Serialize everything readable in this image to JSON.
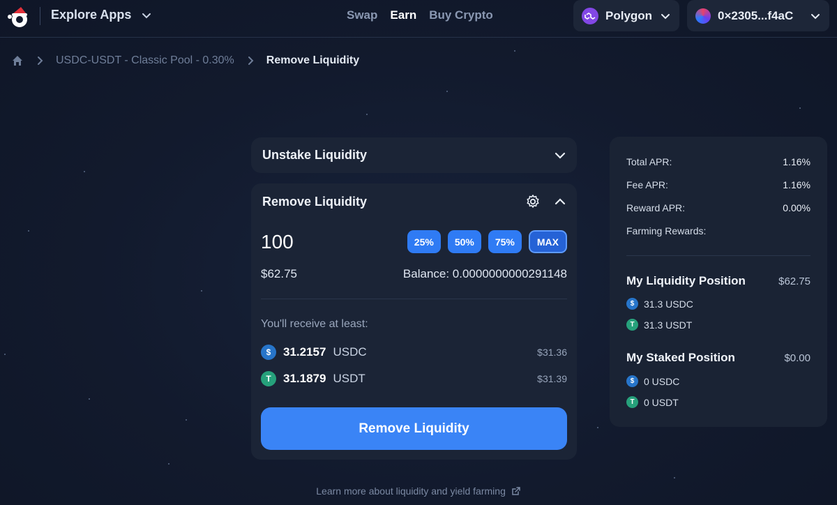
{
  "header": {
    "explore_label": "Explore Apps",
    "nav": [
      {
        "label": "Swap",
        "active": false
      },
      {
        "label": "Earn",
        "active": true
      },
      {
        "label": "Buy Crypto",
        "active": false
      }
    ],
    "network": "Polygon",
    "wallet": "0×2305...f4aC"
  },
  "breadcrumb": {
    "pool": "USDC-USDT - Classic Pool - 0.30%",
    "current": "Remove Liquidity"
  },
  "unstake": {
    "title": "Unstake Liquidity"
  },
  "remove": {
    "title": "Remove Liquidity",
    "amount": "100",
    "presets": [
      "25%",
      "50%",
      "75%",
      "MAX"
    ],
    "usd_value": "$62.75",
    "balance": "Balance: 0.0000000000291148",
    "receive_label": "You'll receive at least:",
    "tokens": [
      {
        "amount": "31.2157",
        "symbol": "USDC",
        "usd": "$31.36"
      },
      {
        "amount": "31.1879",
        "symbol": "USDT",
        "usd": "$31.39"
      }
    ],
    "button": "Remove Liquidity"
  },
  "stats": {
    "total_apr_label": "Total APR:",
    "total_apr": "1.16%",
    "fee_apr_label": "Fee APR:",
    "fee_apr": "1.16%",
    "reward_apr_label": "Reward APR:",
    "reward_apr": "0.00%",
    "farming_label": "Farming Rewards:"
  },
  "liquidity_position": {
    "title": "My Liquidity Position",
    "value": "$62.75",
    "items": [
      "31.3 USDC",
      "31.3 USDT"
    ]
  },
  "staked_position": {
    "title": "My Staked Position",
    "value": "$0.00",
    "items": [
      "0 USDC",
      "0 USDT"
    ]
  },
  "footer": {
    "link": "Learn more about liquidity and yield farming"
  },
  "colors": {
    "accent": "#3a84f6",
    "background": "#121a2d",
    "card": "#1b2436",
    "polygon": "#8247e5",
    "usdc": "#2775ca",
    "usdt": "#26a17b"
  }
}
